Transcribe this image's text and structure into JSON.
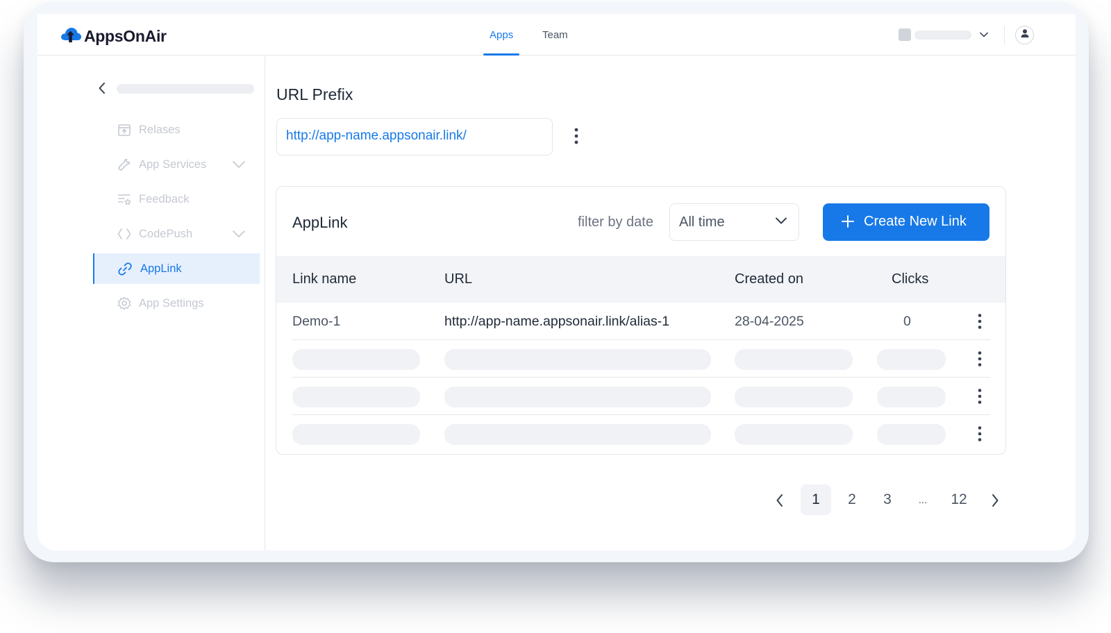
{
  "brand": {
    "name": "AppsOnAir",
    "accent": "#1779e8"
  },
  "header": {
    "tabs": [
      {
        "label": "Apps",
        "active": true
      },
      {
        "label": "Team",
        "active": false
      }
    ]
  },
  "sidebar": {
    "items": [
      {
        "label": "Relases",
        "icon": "release-icon",
        "active": false,
        "expandable": false
      },
      {
        "label": "App Services",
        "icon": "wrench-icon",
        "active": false,
        "expandable": true
      },
      {
        "label": "Feedback",
        "icon": "feedback-icon",
        "active": false,
        "expandable": false
      },
      {
        "label": "CodePush",
        "icon": "code-icon",
        "active": false,
        "expandable": true
      },
      {
        "label": "AppLink",
        "icon": "link-icon",
        "active": true,
        "expandable": false
      },
      {
        "label": "App Settings",
        "icon": "gear-icon",
        "active": false,
        "expandable": false
      }
    ]
  },
  "url_prefix": {
    "title": "URL Prefix",
    "value": "http://app-name.appsonair.link/"
  },
  "applink": {
    "title": "AppLink",
    "filter_label": "filter by date",
    "filter_value": "All time",
    "create_label": "Create New Link",
    "columns": [
      "Link name",
      "URL",
      "Created on",
      "Clicks"
    ],
    "rows": [
      {
        "name": "Demo-1",
        "url": "http://app-name.appsonair.link/alias-1",
        "created": "28-04-2025",
        "clicks": "0"
      }
    ]
  },
  "pagination": {
    "pages": [
      "1",
      "2",
      "3",
      "...",
      "12"
    ],
    "current": "1"
  }
}
